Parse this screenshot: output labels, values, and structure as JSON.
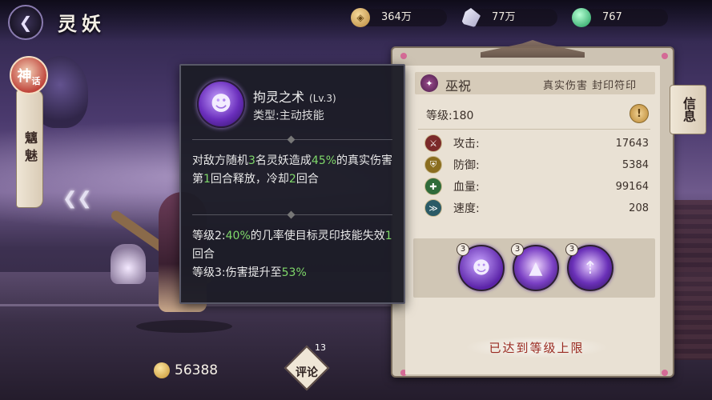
{
  "header": {
    "title": "灵妖",
    "back_icon": "back-arrow-icon"
  },
  "resources": {
    "coin": {
      "icon": "coin-icon",
      "value": "364万"
    },
    "jade": {
      "icon": "jade-crystal-icon",
      "value": "77万"
    },
    "gem": {
      "icon": "green-gem-icon",
      "value": "767"
    }
  },
  "sidebar": {
    "badge_main": "神",
    "badge_sub": "话",
    "tab_label": "魑魅"
  },
  "bottom": {
    "currency_value": "56388",
    "comment_label": "评论",
    "comment_count": "13"
  },
  "skill_popup": {
    "name": "拘灵之术",
    "level": "(Lv.3)",
    "type": "类型:主动技能",
    "desc": {
      "p1_a": "对敌方随机",
      "p1_n1": "3",
      "p1_b": "名灵妖造成",
      "p1_n2": "45%",
      "p1_c": "的真实伤害",
      "p2_a": "第",
      "p2_n1": "1",
      "p2_b": "回合释放，冷却",
      "p2_n2": "2",
      "p2_c": "回合"
    },
    "upgrades": {
      "u1_a": "等级2:",
      "u1_n1": "40%",
      "u1_b": "的几率使目标灵印技能失效",
      "u1_n2": "1",
      "u1_c": "回合",
      "u2_a": "等级3:伤害提升至",
      "u2_n1": "53%"
    },
    "highlight_color": "#7fd86a"
  },
  "info_panel": {
    "role_name": "巫祝",
    "role_tags": "真实伤害 封印符印",
    "info_tab": "信息",
    "level_text": "等级:180",
    "level_button": "!",
    "stats": [
      {
        "icon": "attack-icon",
        "label": "攻击:",
        "value": "17643"
      },
      {
        "icon": "defense-icon",
        "label": "防御:",
        "value": "5384"
      },
      {
        "icon": "hp-icon",
        "label": "血量:",
        "value": "99164"
      },
      {
        "icon": "speed-icon",
        "label": "速度:",
        "value": "208"
      }
    ],
    "skills": [
      {
        "icon": "spirit-skill-icon",
        "level": "3"
      },
      {
        "icon": "seal-skill-icon",
        "level": "3"
      },
      {
        "icon": "buff-skill-icon",
        "level": "3"
      }
    ],
    "max_level_label": "已达到等级上限",
    "max_level_color": "#9a2b22"
  }
}
